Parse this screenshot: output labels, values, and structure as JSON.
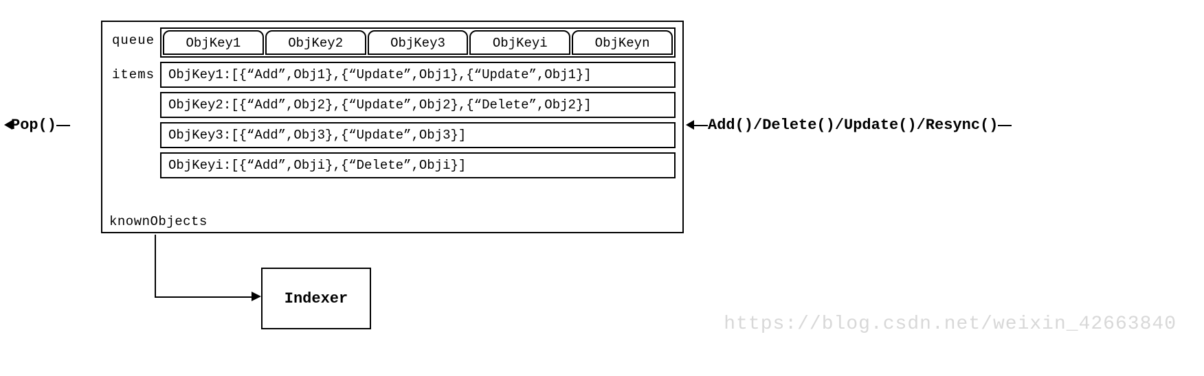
{
  "labels": {
    "queue": "queue",
    "items": "items",
    "known": "knownObjects",
    "indexer": "Indexer",
    "pop": "Pop()",
    "ops": "Add()/Delete()/Update()/Resync()"
  },
  "queue": [
    "ObjKey1",
    "ObjKey2",
    "ObjKey3",
    "ObjKeyi",
    "ObjKeyn"
  ],
  "items": [
    "ObjKey1:[{“Add”,Obj1},{“Update”,Obj1},{“Update”,Obj1}]",
    "ObjKey2:[{“Add”,Obj2},{“Update”,Obj2},{“Delete”,Obj2}]",
    "ObjKey3:[{“Add”,Obj3},{“Update”,Obj3}]",
    "ObjKeyi:[{“Add”,Obji},{“Delete”,Obji}]"
  ],
  "watermark": "https://blog.csdn.net/weixin_42663840"
}
